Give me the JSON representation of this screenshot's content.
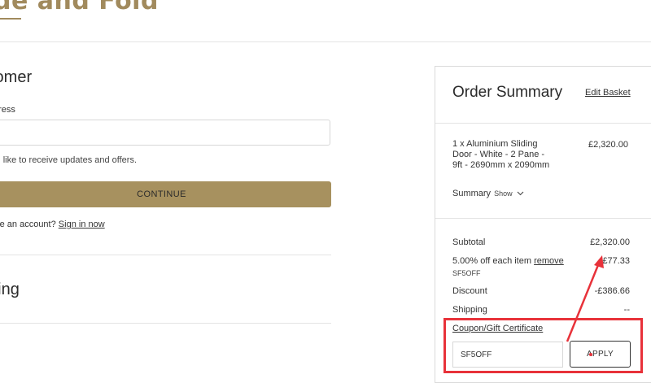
{
  "header": {
    "logo_text": "de and Fold"
  },
  "checkout": {
    "customer": {
      "title": "tomer",
      "email_label": "dress",
      "email_value": "",
      "newsletter_text": "uld like to receive updates and offers.",
      "continue_label": "CONTINUE",
      "account_prompt": "ave an account? ",
      "sign_in_label": "Sign in now"
    },
    "shipping": {
      "title": "ping"
    },
    "billing": {
      "title": "g"
    }
  },
  "order_summary": {
    "title": "Order Summary",
    "edit_basket_label": "Edit Basket",
    "item": {
      "description": "1 x Aluminium Sliding Door - White - 2 Pane - 9ft - 2690mm x 2090mm",
      "price": "£2,320.00",
      "summary_label": "Summary",
      "show_label": "Show"
    },
    "subtotal_label": "Subtotal",
    "subtotal_value": "£2,320.00",
    "promo_label": "5.00% off each item ",
    "promo_remove_label": "remove",
    "promo_value": "-£77.33",
    "promo_code": "SF5OFF",
    "discount_label": "Discount",
    "discount_value": "-£386.66",
    "shipping_label": "Shipping",
    "shipping_value": "--",
    "coupon_link_label": "Coupon/Gift Certificate",
    "coupon_input_value": "SF5OFF",
    "apply_label": "APPLY"
  },
  "colors": {
    "brand": "#a18a5d",
    "button_bg": "#a7915f",
    "annotation": "#e8323a"
  },
  "icons": {
    "show_toggle": "chevron-down-icon"
  }
}
